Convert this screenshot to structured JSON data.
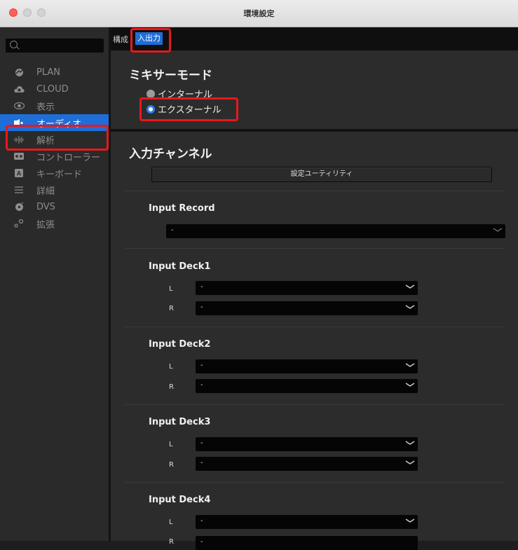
{
  "window": {
    "title": "環境設定"
  },
  "sidebar": {
    "search_placeholder": "",
    "items": [
      {
        "label": "PLAN",
        "icon": "planet-icon"
      },
      {
        "label": "CLOUD",
        "icon": "cloud-icon"
      },
      {
        "label": "表示",
        "icon": "eye-icon"
      },
      {
        "label": "オーディオ",
        "icon": "speaker-icon",
        "active": true
      },
      {
        "label": "解析",
        "icon": "waveform-icon"
      },
      {
        "label": "コントローラー",
        "icon": "controller-icon"
      },
      {
        "label": "キーボード",
        "icon": "keyboard-icon"
      },
      {
        "label": "詳細",
        "icon": "list-icon"
      },
      {
        "label": "DVS",
        "icon": "vinyl-icon"
      },
      {
        "label": "拡張",
        "icon": "extension-icon"
      }
    ]
  },
  "tabs": [
    {
      "label": "構成"
    },
    {
      "label": "入出力",
      "active": true
    }
  ],
  "mixer_mode": {
    "title": "ミキサーモード",
    "options": [
      {
        "label": "インターナル",
        "selected": false
      },
      {
        "label": "エクスターナル",
        "selected": true
      }
    ]
  },
  "input_channels": {
    "title": "入力チャンネル",
    "utility_button": "設定ユーティリティ",
    "record": {
      "label": "Input Record",
      "value": "-"
    },
    "decks": [
      {
        "label": "Input Deck1",
        "L": "-",
        "R": "-"
      },
      {
        "label": "Input Deck2",
        "L": "-",
        "R": "-"
      },
      {
        "label": "Input Deck3",
        "L": "-",
        "R": "-"
      },
      {
        "label": "Input Deck4",
        "L": "-",
        "R": "-"
      }
    ],
    "channel_labels": {
      "L": "L",
      "R": "R"
    }
  },
  "colors": {
    "accent": "#1f6ed8",
    "highlight": "#e8191b",
    "background": "#2c2c2c"
  }
}
